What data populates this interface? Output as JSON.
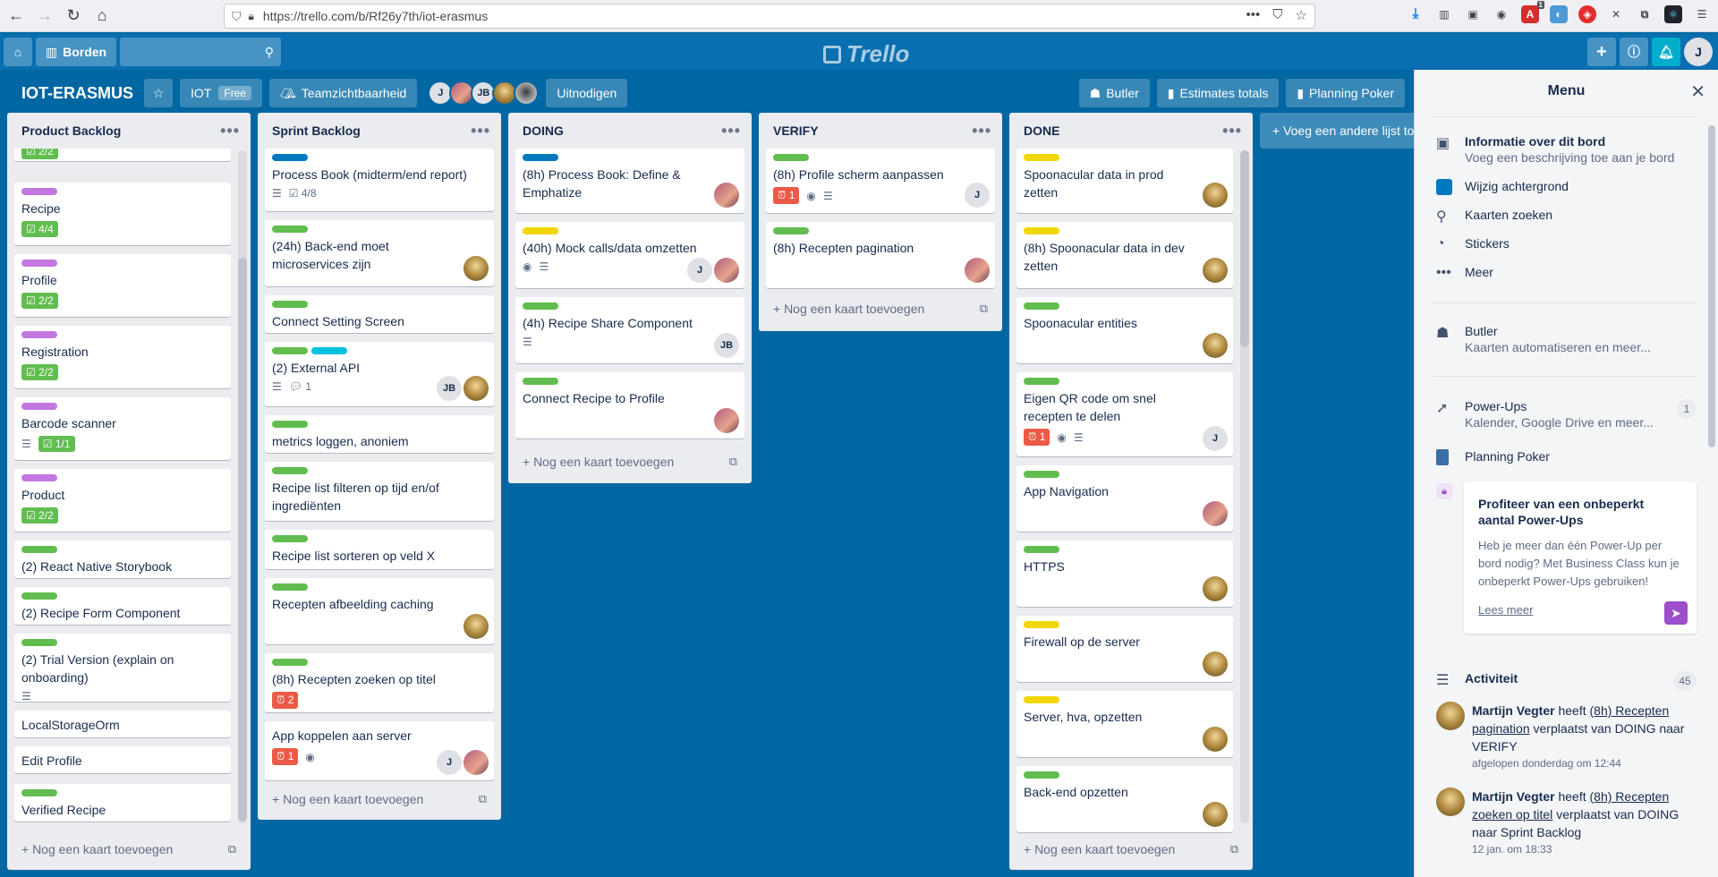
{
  "browser": {
    "url": "https://trello.com/b/Rf26y7th/iot-erasmus",
    "ext_badge": "1"
  },
  "header": {
    "boards_label": "Borden",
    "logo": "Trello",
    "user_initial": "J"
  },
  "board": {
    "title": "IOT-ERASMUS",
    "team": "IOT",
    "team_badge": "Free",
    "visibility": "Teamzichtbaarheid",
    "members": [
      "J",
      "",
      "JB",
      "",
      ""
    ],
    "invite": "Uitnodigen",
    "butler": "Butler",
    "estimates": "Estimates totals",
    "poker": "Planning Poker",
    "add_list": "+ Voeg een andere lijst toe"
  },
  "colors": {
    "green": "#61bd4f",
    "purple": "#c377e0",
    "blue": "#0079bf",
    "yellow": "#f2d600",
    "sky": "#00c2e0",
    "red": "#eb5a46"
  },
  "lists": [
    {
      "title": "Product Backlog",
      "add": "+ Nog een kaart toevoegen",
      "cards": [
        {
          "text": "",
          "labels": [],
          "check": "2/2"
        },
        {
          "text": "Recipe",
          "labels": [
            "purple"
          ],
          "check": "4/4"
        },
        {
          "text": "Profile",
          "labels": [
            "purple"
          ],
          "check": "2/2"
        },
        {
          "text": "Registration",
          "labels": [
            "purple"
          ],
          "check": "2/2"
        },
        {
          "text": "Barcode scanner",
          "labels": [
            "purple"
          ],
          "check": "1/1",
          "desc": true
        },
        {
          "text": "Product",
          "labels": [
            "purple"
          ],
          "check": "2/2"
        },
        {
          "text": "(2) React Native Storybook",
          "labels": [
            "green"
          ]
        },
        {
          "text": "(2) Recipe Form Component",
          "labels": [
            "green"
          ]
        },
        {
          "text": "(2) Trial Version (explain on onboarding)",
          "labels": [
            "green"
          ],
          "desc": true
        },
        {
          "text": "LocalStorageOrm",
          "labels": []
        },
        {
          "text": "Edit Profile",
          "labels": []
        },
        {
          "text": "Verified Recipe",
          "labels": [
            "green"
          ]
        }
      ]
    },
    {
      "title": "Sprint Backlog",
      "add": "+ Nog een kaart toevoegen",
      "cards": [
        {
          "text": "Process Book (midterm/end report)",
          "labels": [
            "blue"
          ],
          "desc": true,
          "check_plain": "4/8"
        },
        {
          "text": "(24h) Back-end moet microservices zijn",
          "labels": [
            "green"
          ],
          "avatars": [
            "photo2"
          ]
        },
        {
          "text": "Connect Setting Screen",
          "labels": [
            "green"
          ]
        },
        {
          "text": "(2) External API",
          "labels": [
            "green",
            "sky"
          ],
          "desc": true,
          "comments": "1",
          "avatars": [
            "JB",
            "photo2"
          ]
        },
        {
          "text": "metrics loggen, anoniem",
          "labels": [
            "green"
          ]
        },
        {
          "text": "Recipe list filteren op tijd en/of ingrediënten",
          "labels": [
            "green"
          ]
        },
        {
          "text": "Recipe list sorteren op veld X",
          "labels": [
            "green"
          ]
        },
        {
          "text": "Recepten afbeelding caching",
          "labels": [
            "green"
          ],
          "avatars": [
            "photo2"
          ]
        },
        {
          "text": "(8h) Recepten zoeken op titel",
          "labels": [
            "green"
          ],
          "alarm": "2"
        },
        {
          "text": "App koppelen aan server",
          "labels": [],
          "alarm": "1",
          "watch": true,
          "avatars": [
            "J",
            "photo1"
          ]
        }
      ]
    },
    {
      "title": "DOING",
      "add": "+ Nog een kaart toevoegen",
      "cards": [
        {
          "text": "(8h) Process Book: Define & Emphatize",
          "labels": [
            "blue"
          ],
          "avatars": [
            "photo1"
          ]
        },
        {
          "text": "(40h) Mock calls/data omzetten",
          "labels": [
            "yellow"
          ],
          "watch": true,
          "desc": true,
          "avatars": [
            "J",
            "photo1"
          ]
        },
        {
          "text": "(4h) Recipe Share Component",
          "labels": [
            "green"
          ],
          "desc": true,
          "avatars": [
            "JB"
          ]
        },
        {
          "text": "Connect Recipe to Profile",
          "labels": [
            "green"
          ],
          "avatars": [
            "photo1"
          ]
        }
      ]
    },
    {
      "title": "VERIFY",
      "add": "+ Nog een kaart toevoegen",
      "cards": [
        {
          "text": "(8h) Profile scherm aanpassen",
          "labels": [
            "green"
          ],
          "alarm": "1",
          "watch": true,
          "desc": true,
          "avatars": [
            "J"
          ]
        },
        {
          "text": "(8h) Recepten pagination",
          "labels": [
            "green"
          ],
          "avatars": [
            "photo1"
          ]
        }
      ]
    },
    {
      "title": "DONE",
      "add": "+ Nog een kaart toevoegen",
      "cards": [
        {
          "text": "Spoonacular data in prod zetten",
          "labels": [
            "yellow"
          ],
          "avatars": [
            "photo2"
          ]
        },
        {
          "text": "(8h) Spoonacular data in dev zetten",
          "labels": [
            "yellow"
          ],
          "avatars": [
            "photo2"
          ]
        },
        {
          "text": "Spoonacular entities",
          "labels": [
            "green"
          ],
          "avatars": [
            "photo2"
          ]
        },
        {
          "text": "Eigen QR code om snel recepten te delen",
          "labels": [
            "green"
          ],
          "alarm": "1",
          "watch": true,
          "desc": true,
          "avatars": [
            "J"
          ]
        },
        {
          "text": "App Navigation",
          "labels": [
            "green"
          ],
          "avatars": [
            "photo1"
          ]
        },
        {
          "text": "HTTPS",
          "labels": [
            "green"
          ],
          "avatars": [
            "photo2"
          ]
        },
        {
          "text": "Firewall op de server",
          "labels": [
            "yellow"
          ],
          "avatars": [
            "photo2"
          ]
        },
        {
          "text": "Server, hva, opzetten",
          "labels": [
            "yellow"
          ],
          "avatars": [
            "photo2"
          ]
        },
        {
          "text": "Back-end opzetten",
          "labels": [
            "green"
          ],
          "avatars": [
            "photo2"
          ]
        }
      ]
    }
  ],
  "menu": {
    "title": "Menu",
    "about_title": "Informatie over dit bord",
    "about_sub": "Voeg een beschrijving toe aan je bord",
    "background": "Wijzig achtergrond",
    "search": "Kaarten zoeken",
    "stickers": "Stickers",
    "more": "Meer",
    "butler_title": "Butler",
    "butler_sub": "Kaarten automatiseren en meer...",
    "powerups_title": "Power-Ups",
    "powerups_sub": "Kalender, Google Drive en meer...",
    "powerups_count": "1",
    "poker": "Planning Poker",
    "upsell_title": "Profiteer van een onbeperkt aantal Power-Ups",
    "upsell_body": "Heb je meer dan één Power-Up per bord nodig? Met Business Class kun je onbeperkt Power-Ups gebruiken!",
    "upsell_link": "Lees meer",
    "activity_title": "Activiteit",
    "activity_count": "45",
    "activity": [
      {
        "user": "Martijn Vegter",
        "verb": "heeft",
        "card": "(8h) Recepten pagination",
        "rest": "verplaatst van DOING naar VERIFY",
        "time": "afgelopen donderdag om 12:44"
      },
      {
        "user": "Martijn Vegter",
        "verb": "heeft",
        "card": "(8h) Recepten zoeken op titel",
        "rest": "verplaatst van DOING naar Sprint Backlog",
        "time": "12 jan. om 18:33"
      }
    ]
  }
}
